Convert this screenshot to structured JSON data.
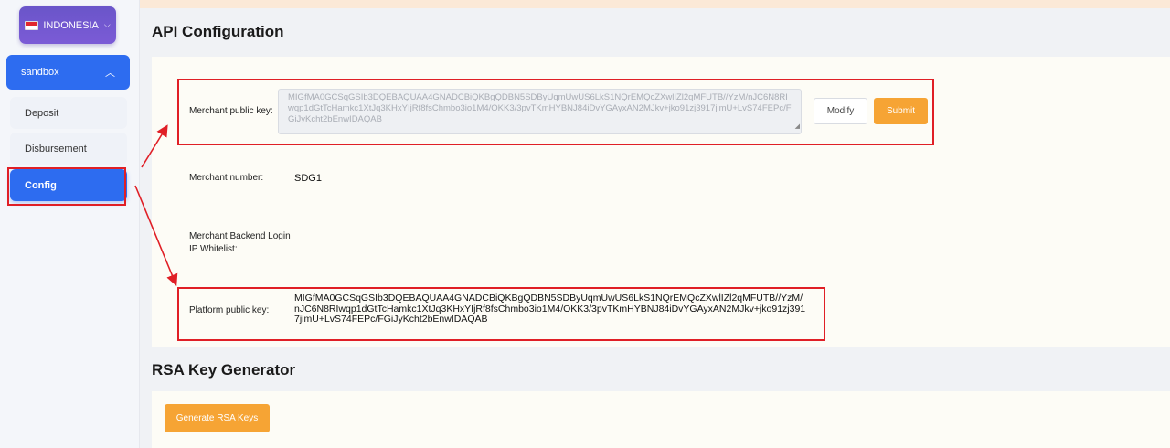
{
  "sidebar": {
    "country": "INDONESIA",
    "environment": "sandbox",
    "items": [
      {
        "label": "Deposit"
      },
      {
        "label": "Disbursement"
      },
      {
        "label": "Config"
      }
    ]
  },
  "api_config": {
    "title": "API Configuration",
    "merchant_public_key_label": "Merchant public key:",
    "merchant_public_key_value": "MIGfMA0GCSqGSIb3DQEBAQUAA4GNADCBiQKBgQDBN5SDByUqmUwUS6LkS1NQrEMQcZXwlIZl2qMFUTB//YzM/nJC6N8RIwqp1dGtTcHamkc1XtJq3KHxYIjRf8fsChmbo3io1M4/OKK3/3pvTKmHYBNJ84iDvYGAyxAN2MJkv+jko91zj3917jimU+LvS74FEPc/FGiJyKcht2bEnwIDAQAB",
    "modify_label": "Modify",
    "submit_label": "Submit",
    "merchant_number_label": "Merchant number:",
    "merchant_number_value": "SDG1",
    "ip_whitelist_label_line1": "Merchant Backend Login",
    "ip_whitelist_label_line2": "IP Whitelist:",
    "platform_public_key_label": "Platform public key:",
    "platform_public_key_value": "MIGfMA0GCSqGSIb3DQEBAQUAA4GNADCBiQKBgQDBN5SDByUqmUwUS6LkS1NQrEMQcZXwlIZl2qMFUTB//YzM/nJC6N8RIwqp1dGtTcHamkc1XtJq3KHxYIjRf8fsChmbo3io1M4/OKK3/3pvTKmHYBNJ84iDvYGAyxAN2MJkv+jko91zj3917jimU+LvS74FEPc/FGiJyKcht2bEnwIDAQAB"
  },
  "rsa": {
    "title": "RSA Key Generator",
    "generate_label": "Generate RSA Keys"
  },
  "colors": {
    "primary": "#2d6cf0",
    "accent_orange": "#f6a434",
    "annotation_red": "#e01f26",
    "country_purple": "#6a55c9"
  }
}
